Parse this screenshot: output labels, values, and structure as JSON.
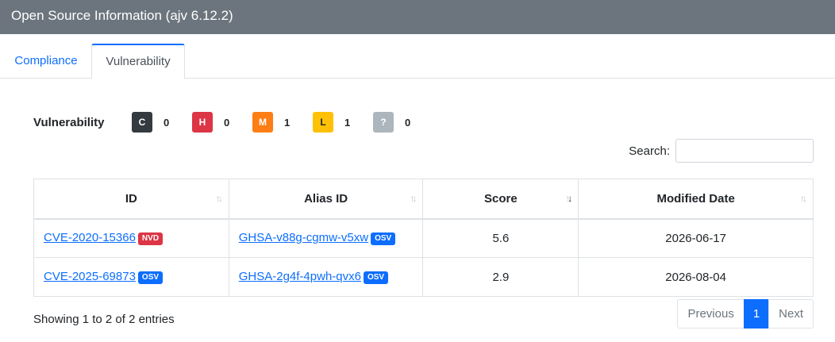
{
  "header": {
    "title": "Open Source Information (ajv 6.12.2)"
  },
  "tabs": [
    {
      "label": "Compliance",
      "active": false
    },
    {
      "label": "Vulnerability",
      "active": true
    }
  ],
  "summary": {
    "label": "Vulnerability",
    "severities": [
      {
        "code": "C",
        "count": "0",
        "color": "#343a40",
        "text_color": "#ffffff"
      },
      {
        "code": "H",
        "count": "0",
        "color": "#dc3545",
        "text_color": "#ffffff"
      },
      {
        "code": "M",
        "count": "1",
        "color": "#fd7e14",
        "text_color": "#ffffff"
      },
      {
        "code": "L",
        "count": "1",
        "color": "#ffc107",
        "text_color": "#212529"
      },
      {
        "code": "?",
        "count": "0",
        "color": "#adb5bd",
        "text_color": "#ffffff"
      }
    ]
  },
  "search": {
    "label": "Search:",
    "value": ""
  },
  "table": {
    "columns": [
      "ID",
      "Alias ID",
      "Score",
      "Modified Date"
    ],
    "sorted_column": "Score",
    "rows": [
      {
        "id": "CVE-2020-15366",
        "id_source": "NVD",
        "alias": "GHSA-v88g-cgmw-v5xw",
        "alias_source": "OSV",
        "score": "5.6",
        "modified": "2026-06-17"
      },
      {
        "id": "CVE-2025-69873",
        "id_source": "OSV",
        "alias": "GHSA-2g4f-4pwh-qvx6",
        "alias_source": "OSV",
        "score": "2.9",
        "modified": "2026-08-04"
      }
    ]
  },
  "footer": {
    "info": "Showing 1 to 2 of 2 entries"
  },
  "pagination": {
    "previous": "Previous",
    "current": "1",
    "next": "Next"
  },
  "colors": {
    "accent": "#0d6efd",
    "header_bg": "#6c757d",
    "nvd": "#dc3545",
    "osv": "#0d6efd"
  }
}
